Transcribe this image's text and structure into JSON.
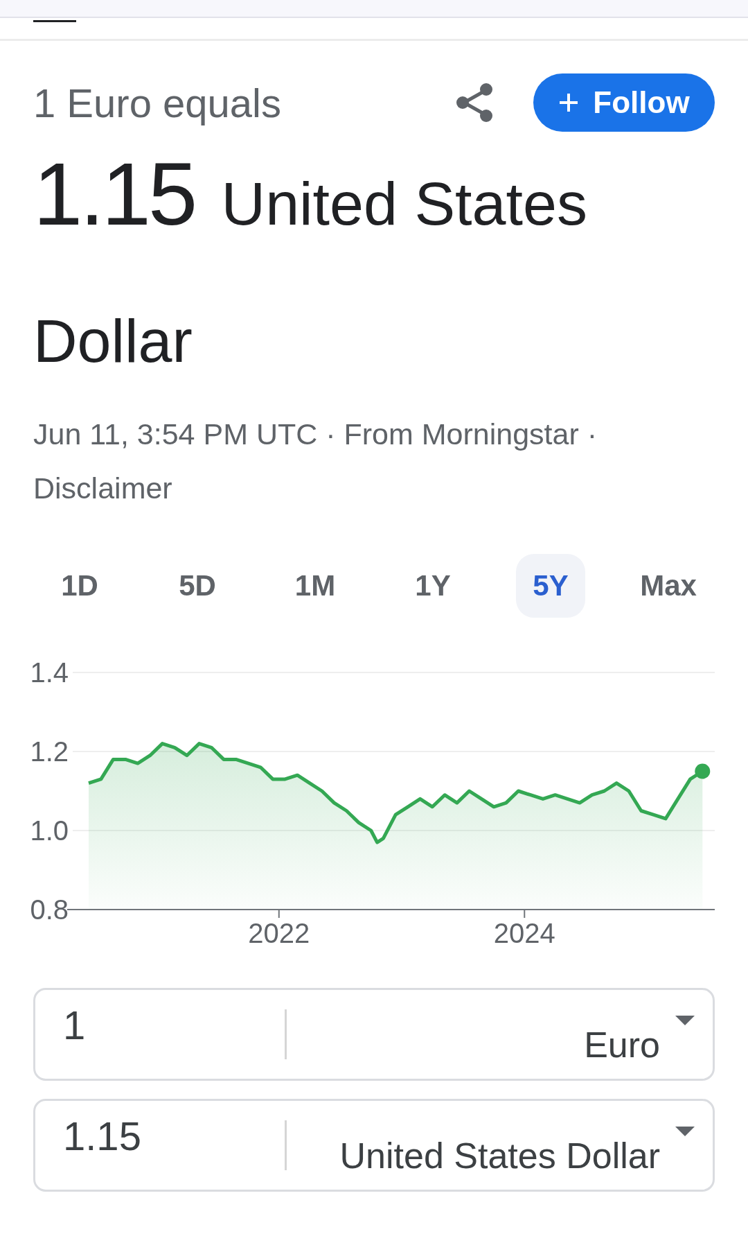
{
  "header": {
    "label": "1 Euro equals",
    "follow_button": {
      "label": "Follow"
    }
  },
  "headline": {
    "value": "1.15",
    "currency": "United States Dollar"
  },
  "meta": {
    "text": "Jun 11, 3:54 PM UTC · From Morningstar ·",
    "link": "Disclaimer"
  },
  "ranges": [
    {
      "label": "1D",
      "selected": false
    },
    {
      "label": "5D",
      "selected": false
    },
    {
      "label": "1M",
      "selected": false
    },
    {
      "label": "1Y",
      "selected": false
    },
    {
      "label": "5Y",
      "selected": true
    },
    {
      "label": "Max",
      "selected": false
    }
  ],
  "chart_data": {
    "type": "area",
    "ylim": [
      0.8,
      1.4
    ],
    "yticks": [
      {
        "value": 0.8,
        "label": "0.8"
      },
      {
        "value": 1.0,
        "label": "1.0"
      },
      {
        "value": 1.2,
        "label": "1.2"
      },
      {
        "value": 1.4,
        "label": "1.4"
      }
    ],
    "xlim": [
      2020.32,
      2025.55
    ],
    "xticks": [
      {
        "value": 2022,
        "label": "2022"
      },
      {
        "value": 2024,
        "label": "2024"
      }
    ],
    "x": [
      2020.45,
      2020.55,
      2020.65,
      2020.75,
      2020.85,
      2020.95,
      2021.05,
      2021.15,
      2021.25,
      2021.35,
      2021.45,
      2021.55,
      2021.65,
      2021.75,
      2021.85,
      2021.95,
      2022.05,
      2022.15,
      2022.25,
      2022.35,
      2022.45,
      2022.55,
      2022.65,
      2022.75,
      2022.8,
      2022.85,
      2022.95,
      2023.05,
      2023.15,
      2023.25,
      2023.35,
      2023.45,
      2023.55,
      2023.65,
      2023.75,
      2023.85,
      2023.95,
      2024.05,
      2024.15,
      2024.25,
      2024.35,
      2024.45,
      2024.55,
      2024.65,
      2024.75,
      2024.85,
      2024.95,
      2025.05,
      2025.15,
      2025.25,
      2025.35,
      2025.45
    ],
    "series": [
      {
        "color": "#34a853",
        "values": [
          1.12,
          1.13,
          1.18,
          1.18,
          1.17,
          1.19,
          1.22,
          1.21,
          1.19,
          1.22,
          1.21,
          1.18,
          1.18,
          1.17,
          1.16,
          1.13,
          1.13,
          1.14,
          1.12,
          1.1,
          1.07,
          1.05,
          1.02,
          1.0,
          0.97,
          0.98,
          1.04,
          1.06,
          1.08,
          1.06,
          1.09,
          1.07,
          1.1,
          1.08,
          1.06,
          1.07,
          1.1,
          1.09,
          1.08,
          1.09,
          1.08,
          1.07,
          1.09,
          1.1,
          1.12,
          1.1,
          1.05,
          1.04,
          1.03,
          1.08,
          1.13,
          1.15
        ]
      }
    ]
  },
  "converter": [
    {
      "amount": "1",
      "currency": "Euro"
    },
    {
      "amount": "1.15",
      "currency": "United States Dollar"
    }
  ]
}
